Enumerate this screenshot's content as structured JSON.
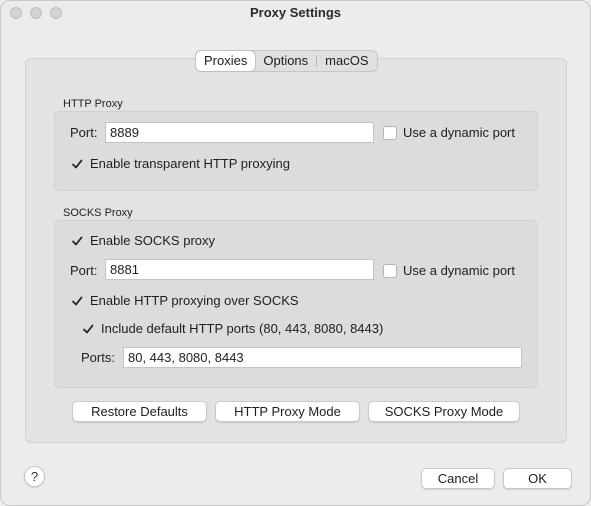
{
  "window": {
    "title": "Proxy Settings"
  },
  "tabs": [
    {
      "label": "Proxies",
      "active": true
    },
    {
      "label": "Options",
      "active": false
    },
    {
      "label": "macOS",
      "active": false
    }
  ],
  "http_proxy": {
    "section_label": "HTTP Proxy",
    "port_label": "Port:",
    "port_value": "8889",
    "dynamic_port_label": "Use a dynamic port",
    "dynamic_port_checked": false,
    "transparent_label": "Enable transparent HTTP proxying",
    "transparent_checked": true
  },
  "socks_proxy": {
    "section_label": "SOCKS Proxy",
    "enable_label": "Enable SOCKS proxy",
    "enable_checked": true,
    "port_label": "Port:",
    "port_value": "8881",
    "dynamic_port_label": "Use a dynamic port",
    "dynamic_port_checked": false,
    "http_over_socks_label": "Enable HTTP proxying over SOCKS",
    "http_over_socks_checked": true,
    "include_ports_label": "Include default HTTP ports (80, 443, 8080, 8443)",
    "include_ports_checked": true,
    "ports_label": "Ports:",
    "ports_value": "80, 443, 8080, 8443"
  },
  "actions": {
    "restore_defaults": "Restore Defaults",
    "http_proxy_mode": "HTTP Proxy Mode",
    "socks_proxy_mode": "SOCKS Proxy Mode"
  },
  "footer": {
    "help": "?",
    "cancel": "Cancel",
    "ok": "OK"
  }
}
